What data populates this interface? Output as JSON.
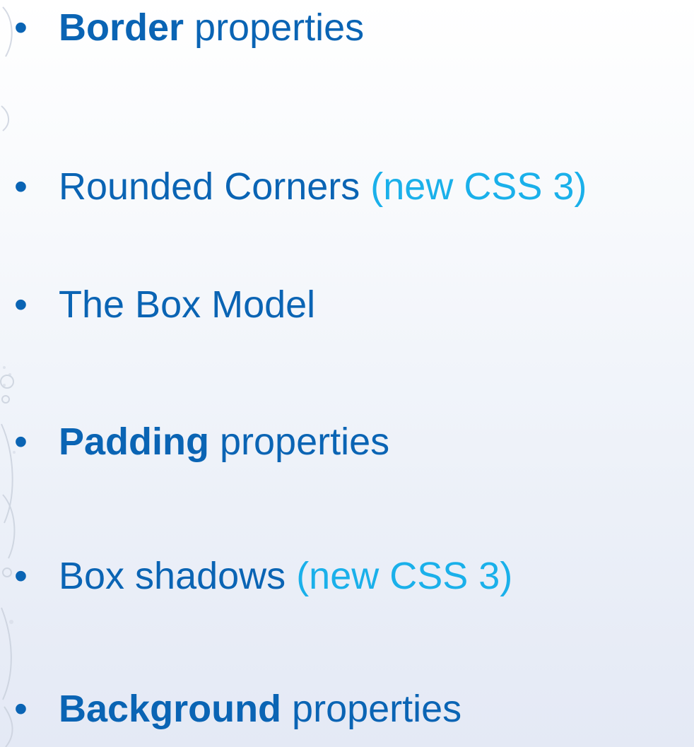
{
  "slide": {
    "bullet_symbol": "•",
    "colors": {
      "text": "#0a64b4",
      "accent": "#1ab0ea",
      "background_top": "#ffffff",
      "background_bottom": "#e4e9f5"
    },
    "decoration": "floral-ornament-left-edge",
    "items": [
      {
        "bold": "Border",
        "text": " properties",
        "note": ""
      },
      {
        "bold": "",
        "text": "Rounded Corners ",
        "note": "(new CSS 3)"
      },
      {
        "bold": "",
        "text": "The Box Model",
        "note": ""
      },
      {
        "bold": "Padding",
        "text": " properties",
        "note": ""
      },
      {
        "bold": "",
        "text": "Box shadows ",
        "note": "(new CSS 3)"
      },
      {
        "bold": "Background",
        "text": " properties",
        "note": ""
      }
    ]
  }
}
